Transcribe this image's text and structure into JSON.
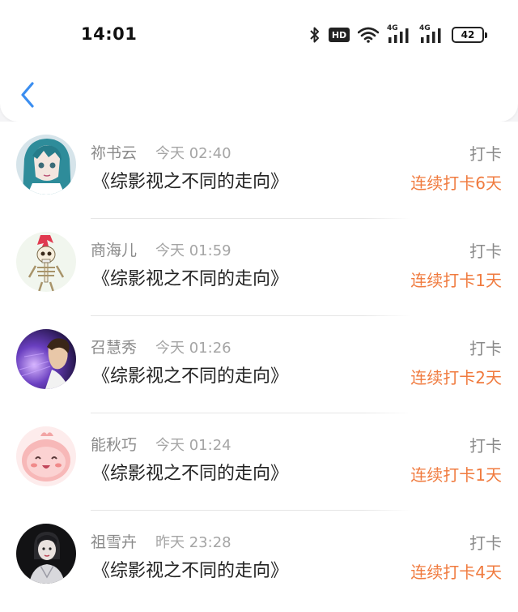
{
  "status_bar": {
    "time": "14:01",
    "hd_label": "HD",
    "signal_labels": [
      "4G",
      "4G"
    ],
    "battery": "42",
    "icons": [
      "bluetooth-icon",
      "hd-icon",
      "wifi-icon",
      "signal-4g-icon",
      "signal-4g-icon",
      "battery-icon"
    ]
  },
  "header": {
    "back_icon": "chevron-left-icon"
  },
  "colors": {
    "accent": "#f07b3f",
    "back": "#3b8ef0"
  },
  "entries": [
    {
      "user": "祢书云",
      "time": "今天 02:40",
      "book": "《综影视之不同的走向》",
      "action": "打卡",
      "streak": "连续打卡6天",
      "avatar": "anime-girl-teal-hair"
    },
    {
      "user": "商海儿",
      "time": "今天 01:59",
      "book": "《综影视之不同的走向》",
      "action": "打卡",
      "streak": "连续打卡1天",
      "avatar": "skeleton-red-mohawk"
    },
    {
      "user": "召慧秀",
      "time": "今天 01:26",
      "book": "《综影视之不同的走向》",
      "action": "打卡",
      "streak": "连续打卡2天",
      "avatar": "man-purple-light"
    },
    {
      "user": "能秋巧",
      "time": "今天 01:24",
      "book": "《综影视之不同的走向》",
      "action": "打卡",
      "streak": "连续打卡1天",
      "avatar": "pink-cute-character"
    },
    {
      "user": "祖雪卉",
      "time": "昨天 23:28",
      "book": "《综影视之不同的走向》",
      "action": "打卡",
      "streak": "连续打卡4天",
      "avatar": "girl-dark-background"
    }
  ]
}
